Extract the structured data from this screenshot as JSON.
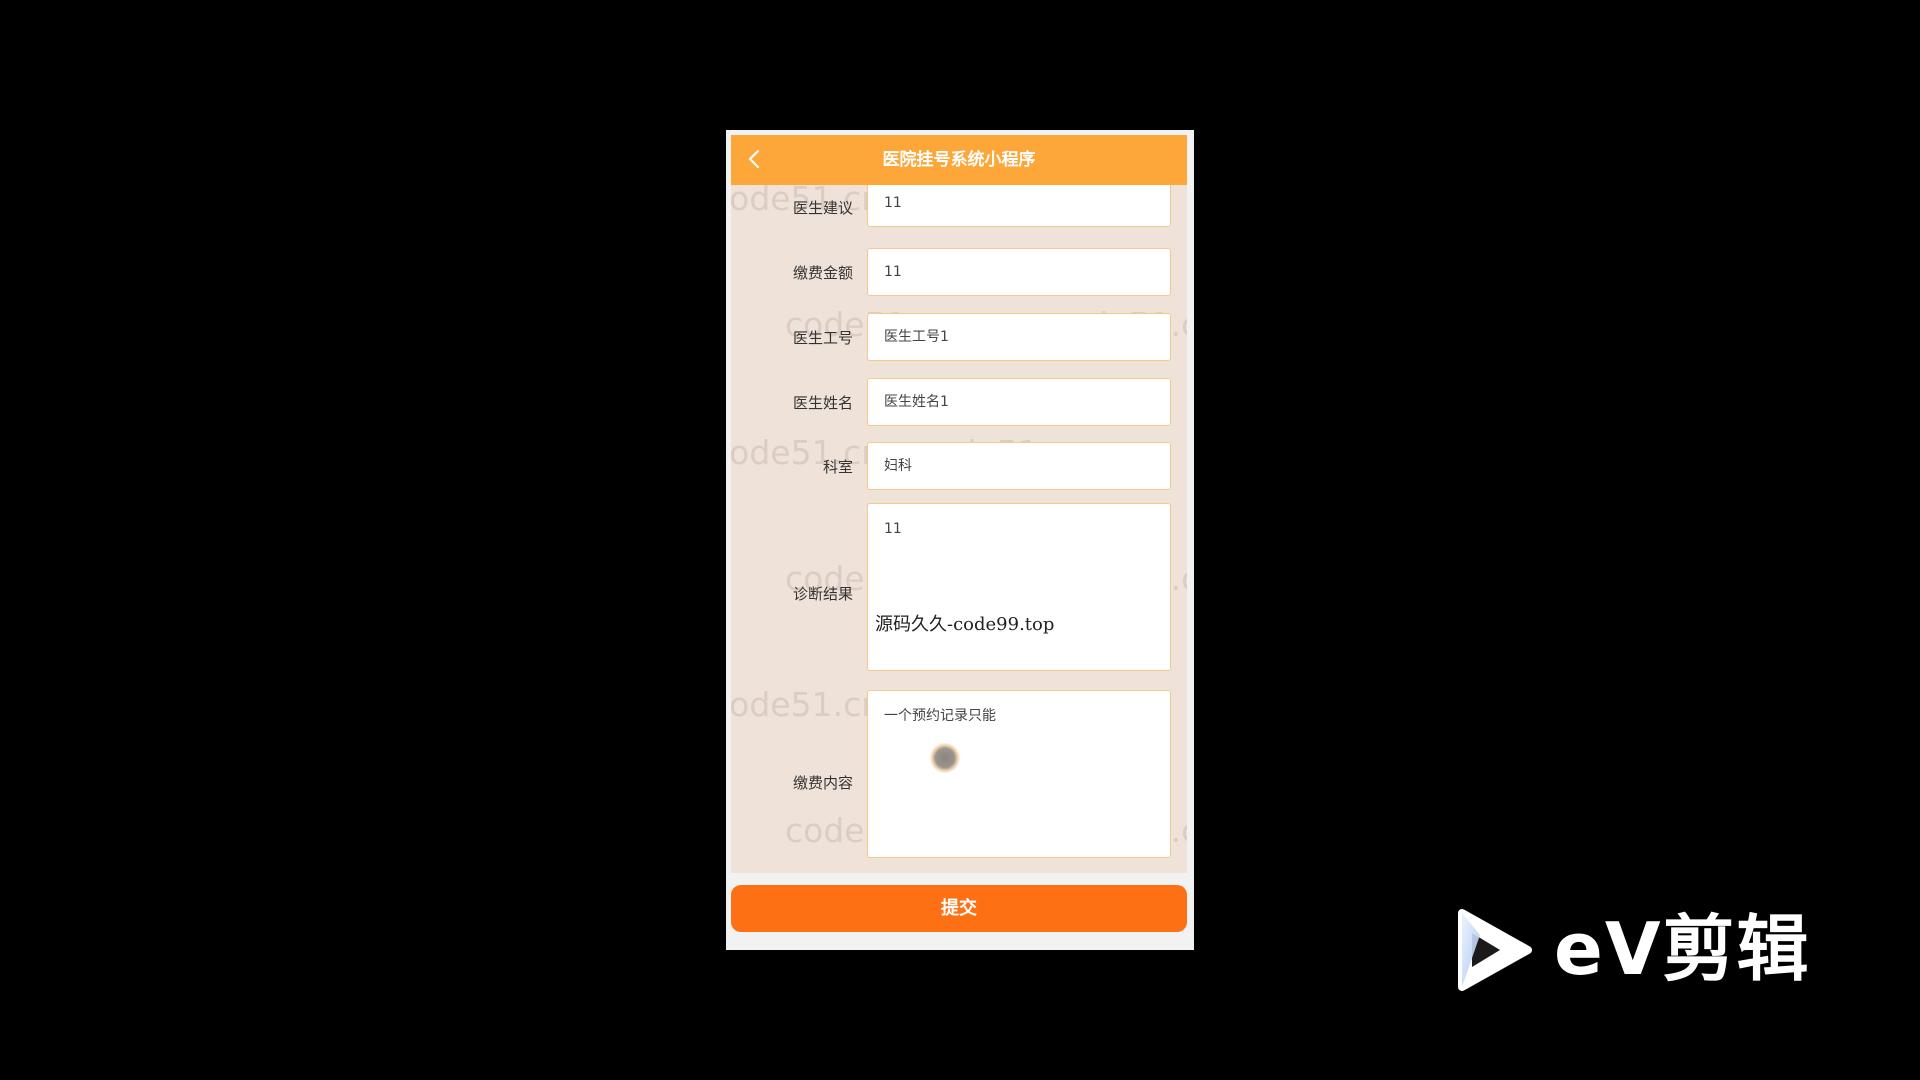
{
  "navbar": {
    "title": "医院挂号系统小程序",
    "back_icon": "chevron-left-icon"
  },
  "form": {
    "fields": [
      {
        "label": "医生建议",
        "value": "11"
      },
      {
        "label": "缴费金额",
        "value": "11"
      },
      {
        "label": "医生工号",
        "value": "医生工号1"
      },
      {
        "label": "医生姓名",
        "value": "医生姓名1"
      },
      {
        "label": "科室",
        "value": "妇科"
      },
      {
        "label": "诊断结果",
        "value": "11"
      },
      {
        "label": "缴费内容",
        "value": "一个预约记录只能"
      }
    ],
    "watermark": "code51.cn"
  },
  "overlay_watermark": "源码久久-code99.top",
  "submit_label": "提交",
  "brand": {
    "name": "eV剪辑",
    "icon": "play-triangle-icon"
  },
  "colors": {
    "navbar": "#fda63a",
    "submit": "#fd7014",
    "form_bg": "#efe3d9",
    "field_border": "#f6c88a"
  }
}
